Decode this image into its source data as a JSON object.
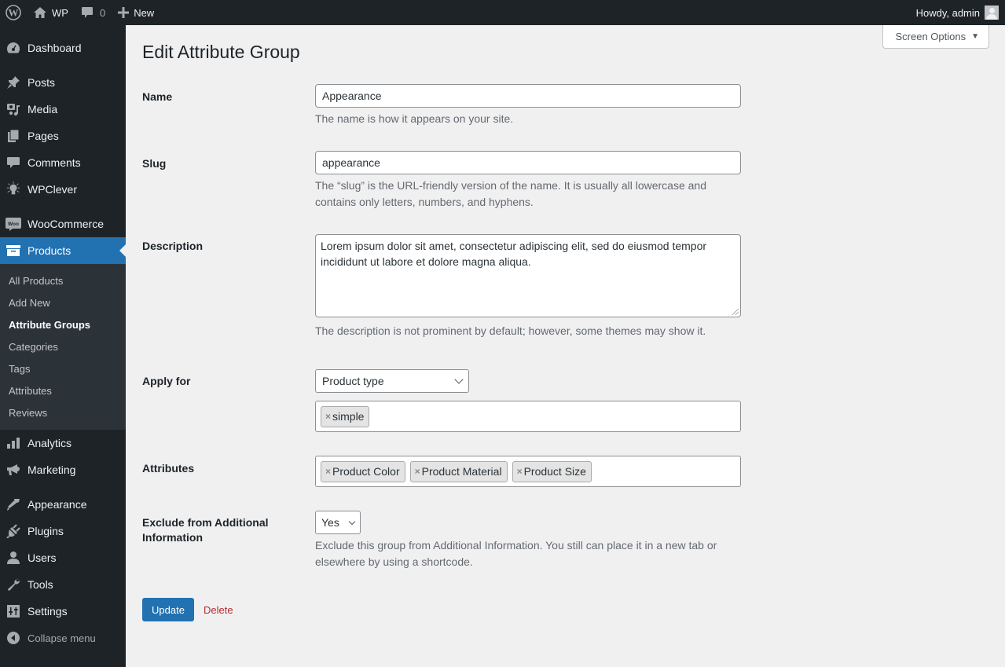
{
  "adminbar": {
    "site_name": "WP",
    "comments_count": "0",
    "new_label": "New",
    "greeting": "Howdy, admin"
  },
  "sidebar": {
    "items": [
      {
        "label": "Dashboard",
        "icon": "dashboard-icon"
      },
      {
        "label": "Posts",
        "icon": "pin-icon"
      },
      {
        "label": "Media",
        "icon": "media-icon"
      },
      {
        "label": "Pages",
        "icon": "pages-icon"
      },
      {
        "label": "Comments",
        "icon": "comment-icon"
      },
      {
        "label": "WPClever",
        "icon": "lightbulb-icon"
      },
      {
        "label": "WooCommerce",
        "icon": "woo-icon"
      },
      {
        "label": "Products",
        "icon": "archive-box-icon",
        "current": true
      },
      {
        "label": "Analytics",
        "icon": "bar-chart-icon"
      },
      {
        "label": "Marketing",
        "icon": "megaphone-icon"
      },
      {
        "label": "Appearance",
        "icon": "paintbrush-icon"
      },
      {
        "label": "Plugins",
        "icon": "plug-icon"
      },
      {
        "label": "Users",
        "icon": "user-icon"
      },
      {
        "label": "Tools",
        "icon": "wrench-icon"
      },
      {
        "label": "Settings",
        "icon": "sliders-icon"
      }
    ],
    "submenu": [
      {
        "label": "All Products"
      },
      {
        "label": "Add New"
      },
      {
        "label": "Attribute Groups",
        "current": true
      },
      {
        "label": "Categories"
      },
      {
        "label": "Tags"
      },
      {
        "label": "Attributes"
      },
      {
        "label": "Reviews"
      }
    ],
    "collapse_label": "Collapse menu"
  },
  "header": {
    "screen_options_label": "Screen Options",
    "title": "Edit Attribute Group"
  },
  "form": {
    "name": {
      "label": "Name",
      "value": "Appearance",
      "description": "The name is how it appears on your site."
    },
    "slug": {
      "label": "Slug",
      "value": "appearance",
      "description": "The “slug” is the URL-friendly version of the name. It is usually all lowercase and contains only letters, numbers, and hyphens."
    },
    "description": {
      "label": "Description",
      "value": "Lorem ipsum dolor sit amet, consectetur adipiscing elit, sed do eiusmod tempor incididunt ut labore et dolore magna aliqua.",
      "help": "The description is not prominent by default; however, some themes may show it."
    },
    "apply_for": {
      "label": "Apply for",
      "selected": "Product type",
      "tags": [
        "simple"
      ]
    },
    "attributes": {
      "label": "Attributes",
      "tags": [
        "Product Color",
        "Product Material",
        "Product Size"
      ]
    },
    "exclude": {
      "label": "Exclude from Additional Information",
      "selected": "Yes",
      "description": "Exclude this group from Additional Information. You still can place it in a new tab or elsewhere by using a shortcode."
    },
    "update_label": "Update",
    "delete_label": "Delete"
  },
  "colors": {
    "accent": "#2271b1",
    "sidebar_bg": "#1d2327",
    "submenu_bg": "#2c3338",
    "delete": "#b32d2e"
  }
}
